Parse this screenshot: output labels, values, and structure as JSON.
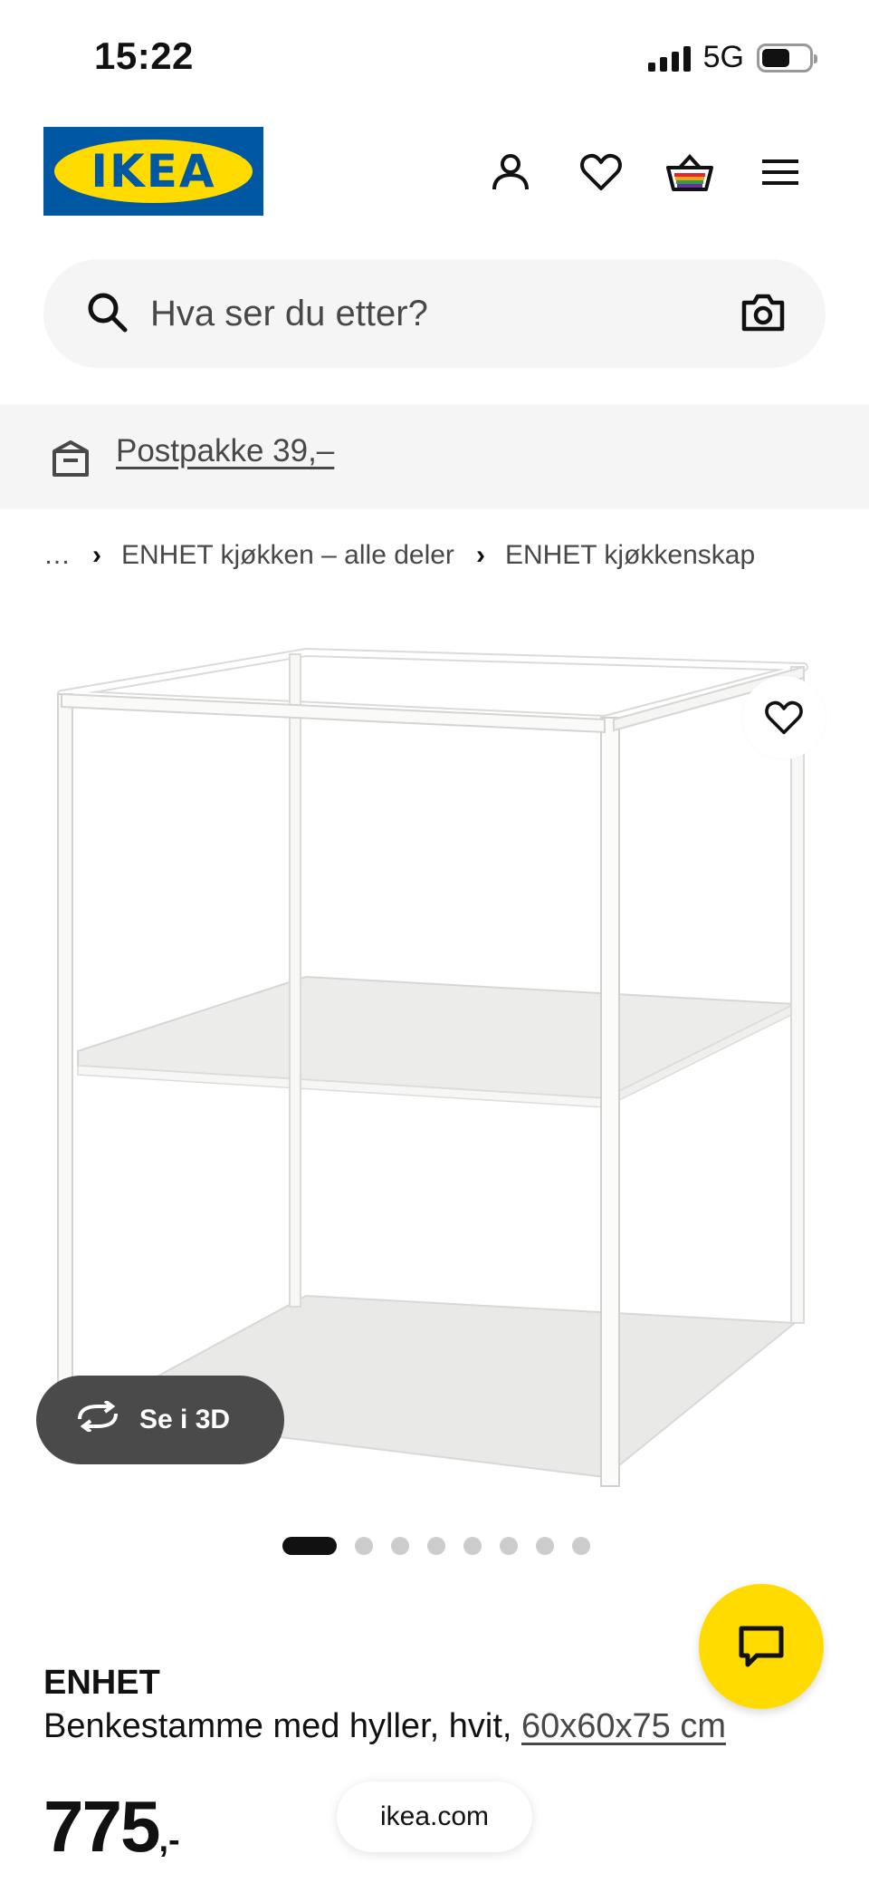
{
  "status_bar": {
    "time": "15:22",
    "network": "5G"
  },
  "header": {
    "logo_text": "IKEA",
    "icons": [
      "profile-icon",
      "heart-icon",
      "basket-icon",
      "menu-icon"
    ]
  },
  "search": {
    "placeholder": "Hva ser du etter?"
  },
  "banner": {
    "label": "Postpakke 39,–"
  },
  "breadcrumb": {
    "ellipsis": "…",
    "items": [
      "ENHET kjøkken – alle deler",
      "ENHET kjøkkenskap"
    ]
  },
  "gallery": {
    "button_3d": "Se i 3D",
    "image_count": 8,
    "active_index": 0
  },
  "product": {
    "name": "ENHET",
    "description": "Benkestamme med hyller, hvit,",
    "dimensions": "60x60x75 cm",
    "price_int": "775",
    "price_suffix": ",-"
  },
  "browser": {
    "url": "ikea.com"
  },
  "colors": {
    "ikea_blue": "#0058a3",
    "ikea_yellow": "#ffdb00",
    "pill_dark": "#4a4a4a"
  }
}
